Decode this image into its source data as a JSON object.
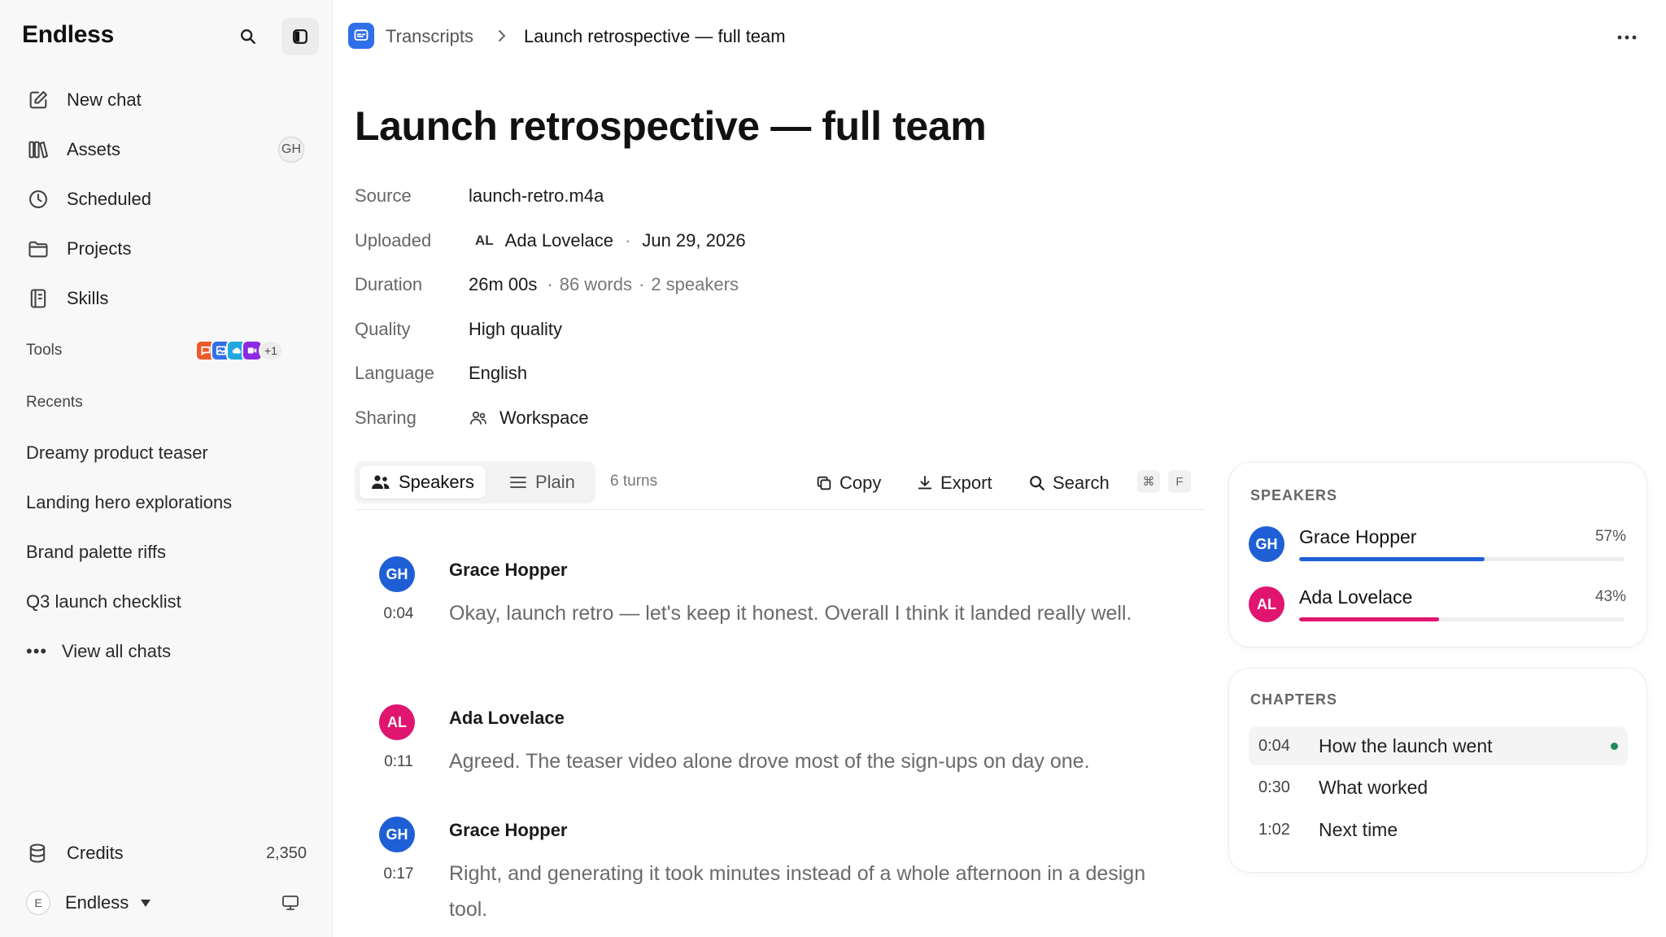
{
  "sidebar": {
    "brand": "Endless",
    "nav": [
      {
        "label": "New chat",
        "icon": "new-chat-icon"
      },
      {
        "label": "Assets",
        "icon": "assets-icon",
        "badge": "GH"
      },
      {
        "label": "Scheduled",
        "icon": "clock-icon"
      },
      {
        "label": "Projects",
        "icon": "folder-icon"
      },
      {
        "label": "Skills",
        "icon": "skills-icon"
      }
    ],
    "tools_label": "Tools",
    "tools_more": "+1",
    "recents_label": "Recents",
    "recents": [
      "Dreamy product teaser",
      "Landing hero explorations",
      "Brand palette riffs",
      "Q3 launch checklist"
    ],
    "view_all": "View all chats",
    "credits_label": "Credits",
    "credits_value": "2,350",
    "workspace_badge": "E",
    "workspace_name": "Endless"
  },
  "breadcrumb": {
    "parent": "Transcripts",
    "current": "Launch retrospective — full team"
  },
  "page": {
    "title": "Launch retrospective — full team",
    "meta": {
      "source_key": "Source",
      "source_val": "launch-retro.m4a",
      "uploaded_key": "Uploaded",
      "uploader_initials": "AL",
      "uploader": "Ada Lovelace",
      "uploaded_date": "Jun 29, 2026",
      "duration_key": "Duration",
      "duration_val": "26m 00s",
      "words": "86 words",
      "speakers": "2 speakers",
      "quality_key": "Quality",
      "quality_val": "High quality",
      "language_key": "Language",
      "language_val": "English",
      "sharing_key": "Sharing",
      "sharing_val": "Workspace"
    }
  },
  "toolbar": {
    "speakers_tab": "Speakers",
    "plain_tab": "Plain",
    "turns": "6 turns",
    "copy": "Copy",
    "export": "Export",
    "search": "Search",
    "kbd_cmd": "⌘",
    "kbd_f": "F"
  },
  "transcript": [
    {
      "initials": "GH",
      "name": "Grace Hopper",
      "time": "0:04",
      "text": "Okay, launch retro — let's keep it honest. Overall I think it landed really well."
    },
    {
      "initials": "AL",
      "name": "Ada Lovelace",
      "time": "0:11",
      "text": "Agreed. The teaser video alone drove most of the sign-ups on day one."
    },
    {
      "initials": "GH",
      "name": "Grace Hopper",
      "time": "0:17",
      "text": "Right, and generating it took minutes instead of a whole afternoon in a design tool."
    }
  ],
  "speakers_card": {
    "title": "SPEAKERS",
    "items": [
      {
        "initials": "GH",
        "name": "Grace Hopper",
        "pct": "57%",
        "fraction": 0.57,
        "color": "#1f5fd6"
      },
      {
        "initials": "AL",
        "name": "Ada Lovelace",
        "pct": "43%",
        "fraction": 0.43,
        "color": "#e0156f"
      }
    ]
  },
  "chapters_card": {
    "title": "CHAPTERS",
    "items": [
      {
        "time": "0:04",
        "title": "How the launch went",
        "active": true
      },
      {
        "time": "0:30",
        "title": "What worked",
        "active": false
      },
      {
        "time": "1:02",
        "title": "Next time",
        "active": false
      }
    ]
  },
  "colors": {
    "accent": "#2f6fe8",
    "grace": "#1f5fd6",
    "ada": "#e0156f",
    "active_dot": "#1f8a57"
  }
}
